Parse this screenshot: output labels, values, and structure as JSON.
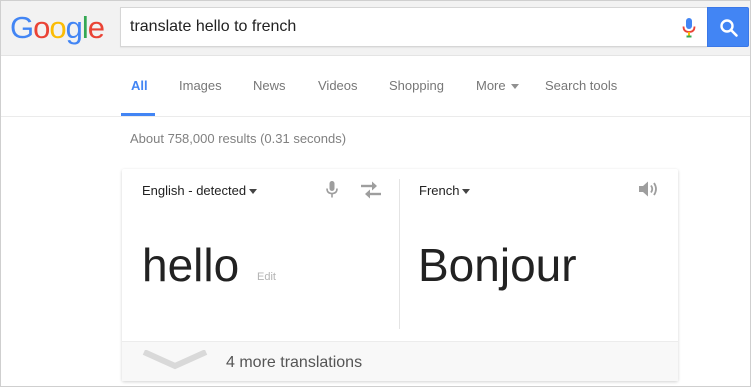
{
  "logo": {
    "letters": [
      "G",
      "o",
      "o",
      "g",
      "l",
      "e"
    ],
    "colors": [
      "#4285f4",
      "#ea4335",
      "#fbbc05",
      "#4285f4",
      "#34a853",
      "#ea4335"
    ]
  },
  "search": {
    "query": "translate hello to french",
    "button_icon": "search-icon",
    "mic_icon": "mic-icon"
  },
  "tabs": {
    "all": "All",
    "images": "Images",
    "news": "News",
    "videos": "Videos",
    "shopping": "Shopping",
    "more": "More",
    "search_tools": "Search tools"
  },
  "stats": "About 758,000 results (0.31 seconds)",
  "translate": {
    "source_lang": "English - detected",
    "target_lang": "French",
    "source_text": "hello",
    "edit_label": "Edit",
    "target_text": "Bonjour",
    "more_translations": "4 more translations"
  },
  "colors": {
    "accent": "#4285f4",
    "header_bg": "#f2f2f2"
  }
}
